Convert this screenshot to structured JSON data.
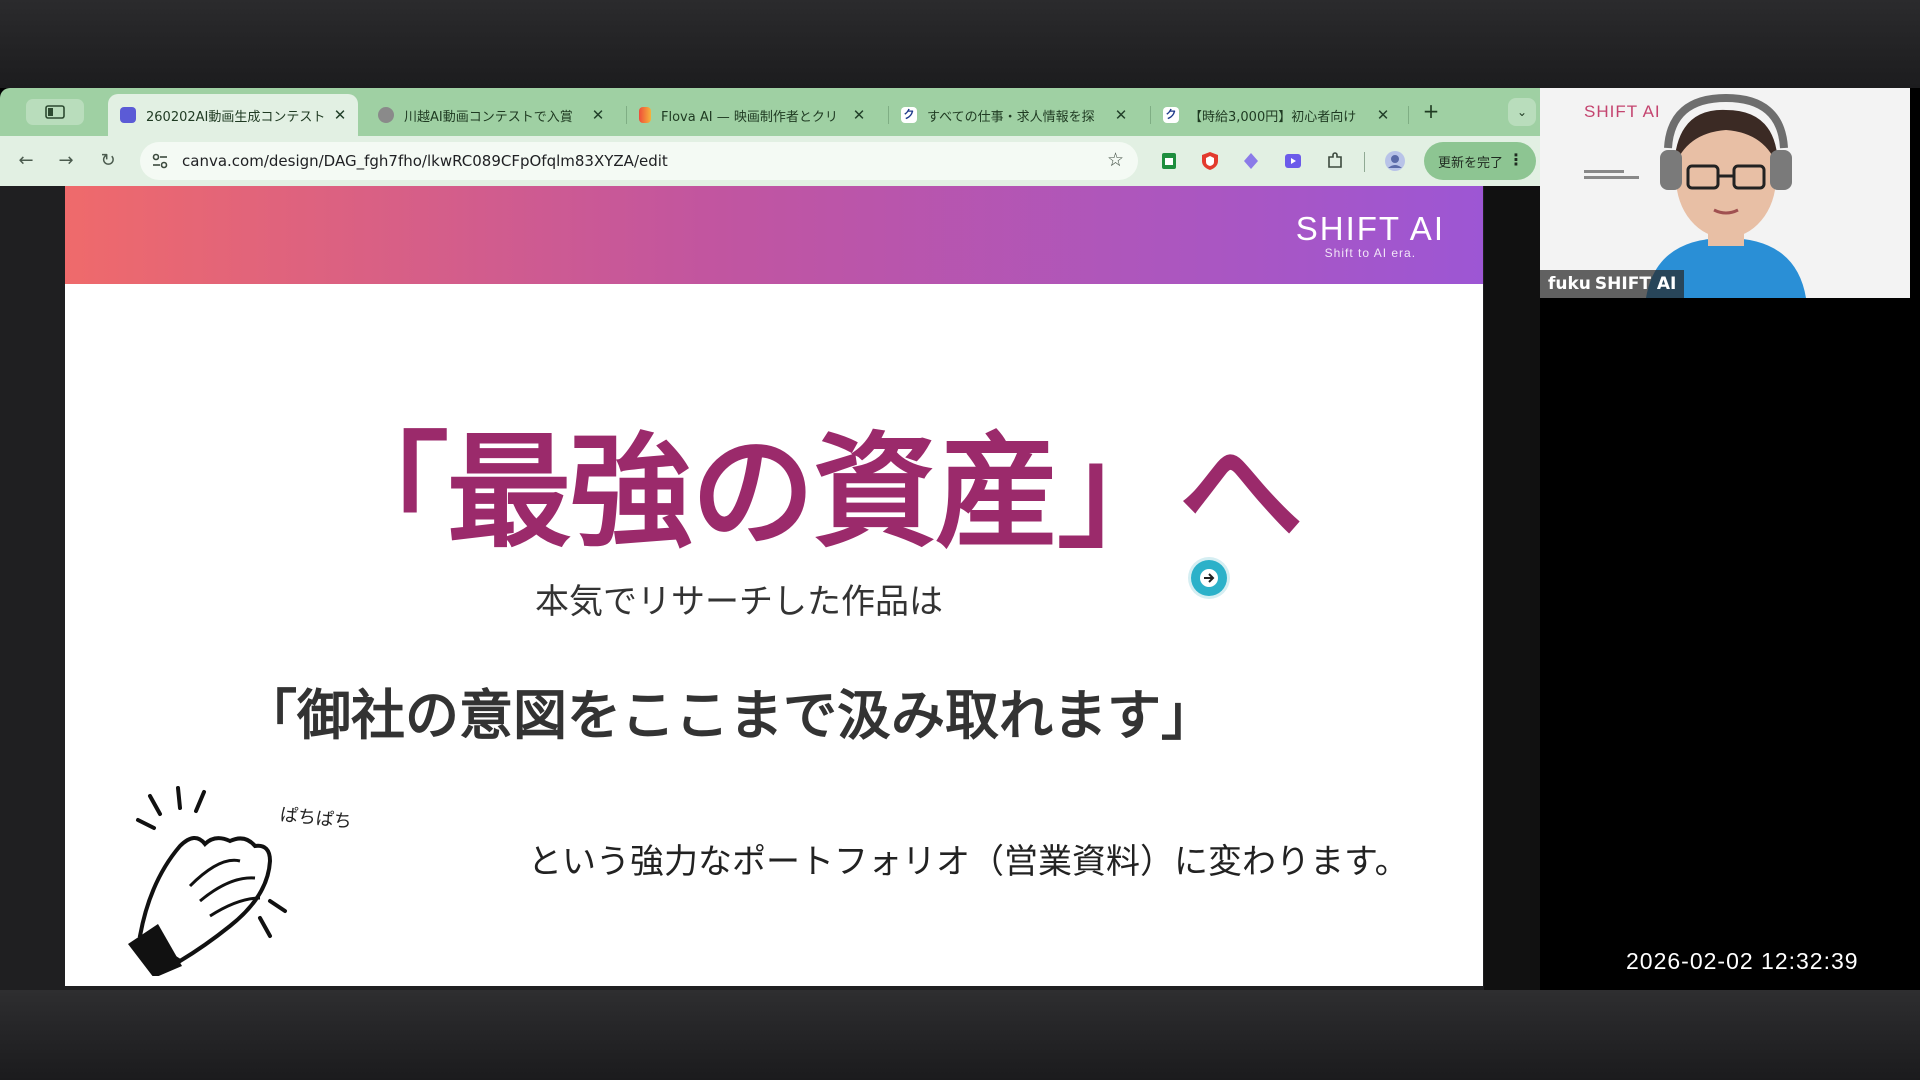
{
  "browser": {
    "tabs": [
      {
        "title": "260202AI動画生成コンテスト",
        "favicon_color": "#5b5bd6",
        "active": true
      },
      {
        "title": "川越AI動画コンテストで入賞",
        "favicon_color": "#6d6d6d",
        "active": false
      },
      {
        "title": "Flova AI — 映画制作者とクリ",
        "favicon_color": "#f0a030",
        "active": false
      },
      {
        "title": "すべての仕事・求人情報を探",
        "favicon_color": "#1e3a8a",
        "active": false
      },
      {
        "title": "【時給3,000円】初心者向け",
        "favicon_color": "#1e3a8a",
        "active": false
      }
    ],
    "new_tab_label": "+",
    "url": "canva.com/design/DAG_fgh7fho/lkwRC089CFpOfqlm83XYZA/edit",
    "update_button_label": "更新を完了",
    "theme_color": "#9fd0a3"
  },
  "slide": {
    "brand_name": "SHIFT AI",
    "brand_tagline": "Shift to AI era.",
    "headline": "「最強の資産」へ",
    "subtext": "本気でリサーチした作品は",
    "quote": "「御社の意図をここまで汲み取れます」",
    "note": "ぱちぱち",
    "bottom_text": "という強力なポートフォリオ（営業資料）に変わります。",
    "accent_color": "#9b2a6b"
  },
  "video": {
    "overlay_brand": "SHIFT AI",
    "participant_name": "fuku",
    "participant_org": "SHIFT AI"
  },
  "timestamp": "2026-02-02  12:32:39"
}
